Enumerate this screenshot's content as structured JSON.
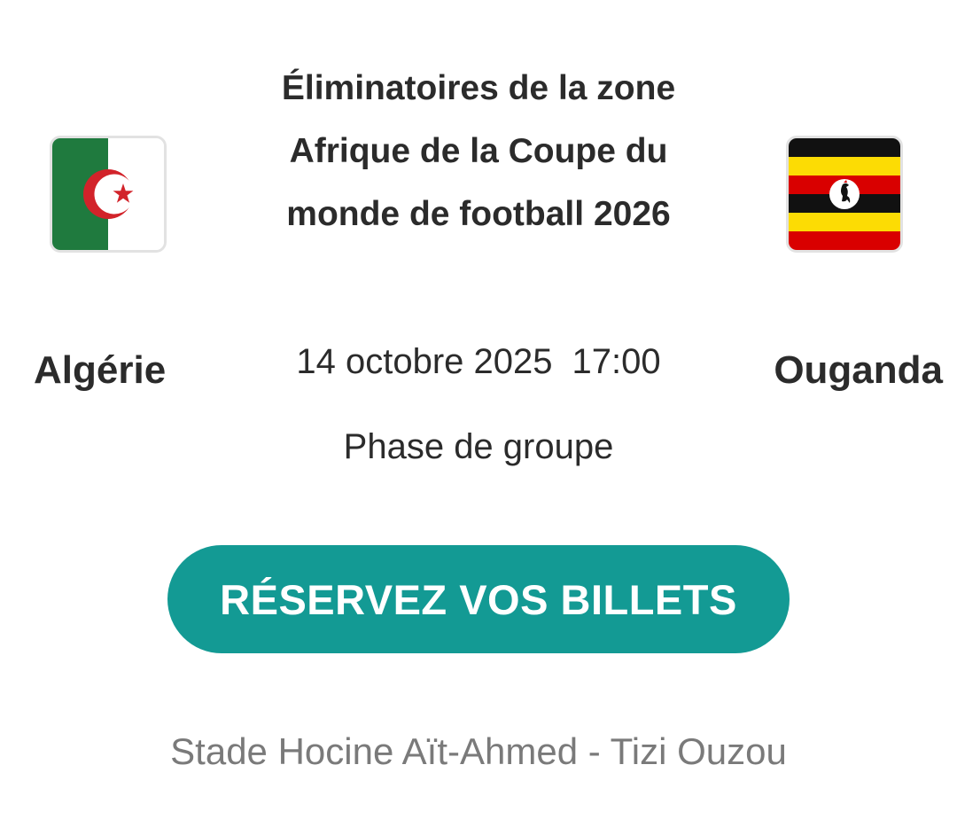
{
  "match": {
    "competition": "Éliminatoires de la zone Afrique de la Coupe du monde de football 2026",
    "date": "14 octobre 2025",
    "time": "17:00",
    "phase": "Phase de groupe",
    "venue": "Stade Hocine Aït-Ahmed - Tizi Ouzou"
  },
  "teams": {
    "home": {
      "name": "Algérie",
      "flag_icon": "algeria-flag-icon"
    },
    "away": {
      "name": "Ouganda",
      "flag_icon": "uganda-flag-icon"
    }
  },
  "cta": {
    "label": "RÉSERVEZ VOS BILLETS"
  },
  "colors": {
    "accent": "#139a94",
    "text_primary": "#2b2b2b",
    "text_muted": "#7a7a7a",
    "algeria_green": "#1f7a3e",
    "algeria_red": "#d2232a",
    "uganda_black": "#111111",
    "uganda_yellow": "#fcdc04",
    "uganda_red": "#d90000"
  }
}
